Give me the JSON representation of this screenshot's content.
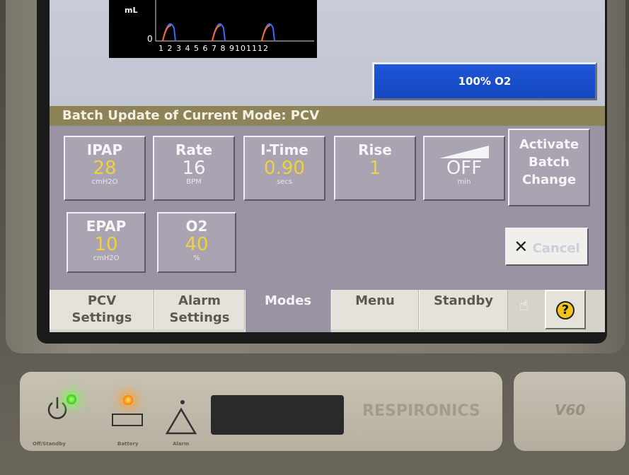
{
  "waveform": {
    "unit_label": "mL",
    "zero_label": "0",
    "x_ticks": "1 2 3 4 5 6 7 8 9101112"
  },
  "o2_bar": {
    "label": "100% O2"
  },
  "title": "Batch Update of Current Mode: PCV",
  "params": {
    "ipap": {
      "label": "IPAP",
      "value": "28",
      "unit": "cmH2O"
    },
    "rate": {
      "label": "Rate",
      "value": "16",
      "unit": "BPM"
    },
    "itime": {
      "label": "I-Time",
      "value": "0.90",
      "unit": "secs"
    },
    "rise": {
      "label": "Rise",
      "value": "1"
    },
    "ramp": {
      "value": "OFF",
      "unit": "min"
    },
    "epap": {
      "label": "EPAP",
      "value": "10",
      "unit": "cmH2O"
    },
    "o2": {
      "label": "O2",
      "value": "40",
      "unit": "%"
    }
  },
  "actions": {
    "activate_line1": "Activate",
    "activate_line2": "Batch",
    "activate_line3": "Change",
    "cancel": "Cancel"
  },
  "tabs": {
    "pcv_settings_1": "PCV",
    "pcv_settings_2": "Settings",
    "alarm_settings_1": "Alarm",
    "alarm_settings_2": "Settings",
    "modes": "Modes",
    "menu": "Menu",
    "standby": "Standby"
  },
  "help": {
    "label": "?"
  },
  "device": {
    "brand": "RESPIRONICS",
    "model": "V60",
    "onoff_label": "Off/Standby",
    "battery_label": "Battery",
    "alarm_label": "Alarm"
  },
  "colors": {
    "title_bar": "#8c8458",
    "panel": "#9a93a4",
    "o2_bar": "#1f56d8",
    "value_highlight": "#f1d23a"
  }
}
